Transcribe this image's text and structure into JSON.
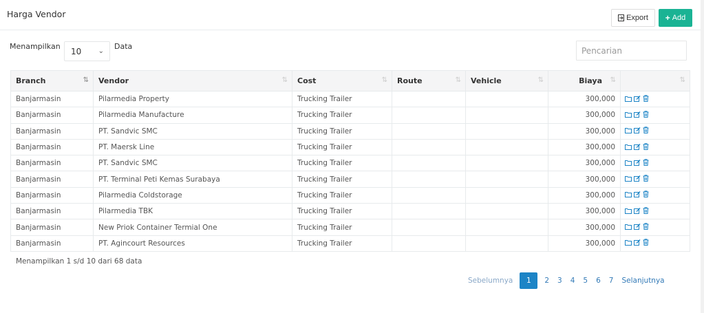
{
  "page": {
    "title": "Harga Vendor"
  },
  "toolbar": {
    "export_label": "Export",
    "add_label": "Add"
  },
  "length": {
    "label": "Menampilkan",
    "value": "10",
    "suffix": "Data"
  },
  "search": {
    "placeholder": "Pencarian"
  },
  "table": {
    "headers": [
      "Branch",
      "Vendor",
      "Cost",
      "Route",
      "Vehicle",
      "Biaya",
      ""
    ],
    "rows": [
      [
        "Banjarmasin",
        "Pilarmedia Property",
        "Trucking Trailer",
        "",
        "",
        "300,000"
      ],
      [
        "Banjarmasin",
        "Pilarmedia Manufacture",
        "Trucking Trailer",
        "",
        "",
        "300,000"
      ],
      [
        "Banjarmasin",
        "PT. Sandvic SMC",
        "Trucking Trailer",
        "",
        "",
        "300,000"
      ],
      [
        "Banjarmasin",
        "PT. Maersk Line",
        "Trucking Trailer",
        "",
        "",
        "300,000"
      ],
      [
        "Banjarmasin",
        "PT. Sandvic SMC",
        "Trucking Trailer",
        "",
        "",
        "300,000"
      ],
      [
        "Banjarmasin",
        "PT. Terminal Peti Kemas Surabaya",
        "Trucking Trailer",
        "",
        "",
        "300,000"
      ],
      [
        "Banjarmasin",
        "Pilarmedia Coldstorage",
        "Trucking Trailer",
        "",
        "",
        "300,000"
      ],
      [
        "Banjarmasin",
        "Pilarmedia TBK",
        "Trucking Trailer",
        "",
        "",
        "300,000"
      ],
      [
        "Banjarmasin",
        "New Priok Container Termial One",
        "Trucking Trailer",
        "",
        "",
        "300,000"
      ],
      [
        "Banjarmasin",
        "PT. Agincourt Resources",
        "Trucking Trailer",
        "",
        "",
        "300,000"
      ]
    ]
  },
  "info": "Menampilkan 1 s/d 10 dari 68 data",
  "pagination": {
    "prev": "Sebelumnya",
    "pages": [
      "1",
      "2",
      "3",
      "4",
      "5",
      "6",
      "7"
    ],
    "active": "1",
    "next": "Selanjutnya"
  },
  "colors": {
    "accent": "#1ab394",
    "primary": "#1c84c6"
  },
  "icons": {
    "export": "file-export-icon",
    "add": "plus-icon",
    "row_actions": [
      "folder-icon",
      "edit-icon",
      "trash-icon"
    ]
  }
}
